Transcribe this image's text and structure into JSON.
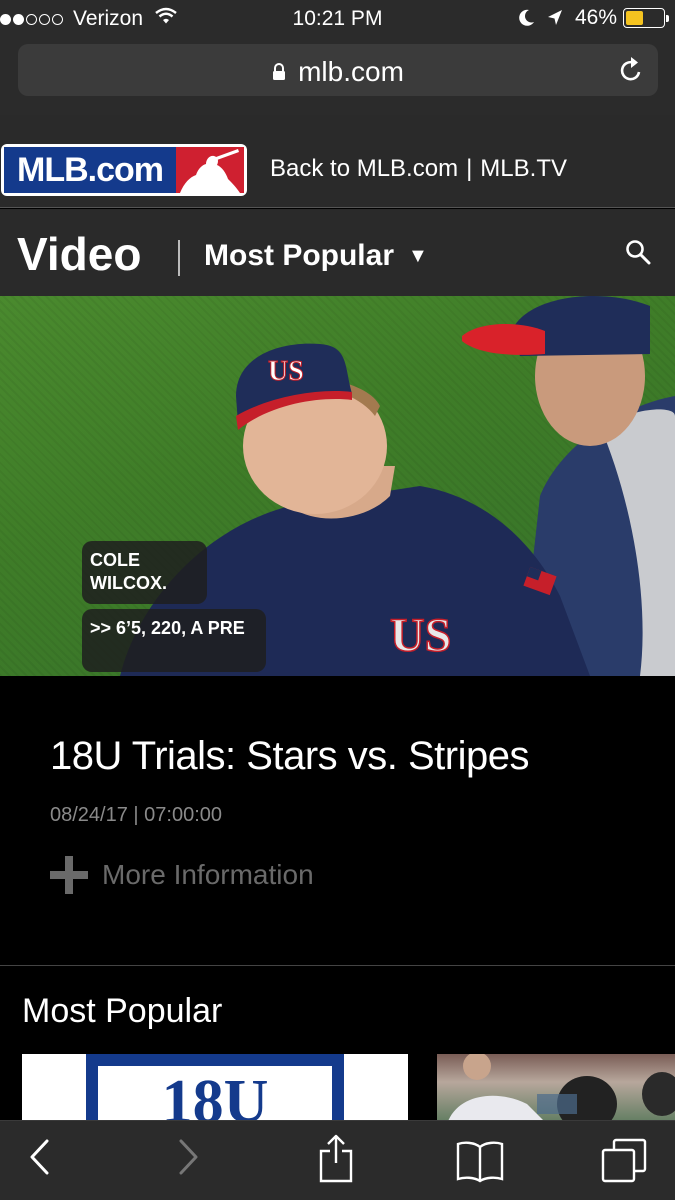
{
  "status_bar": {
    "carrier": "Verizon",
    "signal_bars_filled": 2,
    "signal_bars_total": 5,
    "time": "10:21 PM",
    "battery_percent": "46%",
    "battery_level": 0.46,
    "battery_color": "#f4c320"
  },
  "browser": {
    "url": "mlb.com"
  },
  "header": {
    "logo_text": "MLB.com",
    "back_link": "Back to MLB.com",
    "separator": "|",
    "tv_link": "MLB.TV",
    "brand_blue": "#143a8c",
    "brand_red": "#cf2030"
  },
  "video_nav": {
    "section_title": "Video",
    "dropdown_label": "Most Popular",
    "dropdown_arrow": "▼"
  },
  "player": {
    "caption_1": "COLE WILCOX.",
    "caption_2": ">> 6’5, 220, A PRE"
  },
  "video_info": {
    "headline": "18U Trials: Stars vs. Stripes",
    "date": "08/24/17 | 07:00:00",
    "more_info_label": "More Information"
  },
  "most_popular": {
    "heading": "Most Popular",
    "thumb_1_text": "18U"
  },
  "toolbar": {
    "icons": [
      "back-icon",
      "forward-icon",
      "share-icon",
      "bookmarks-icon",
      "tabs-icon"
    ]
  }
}
